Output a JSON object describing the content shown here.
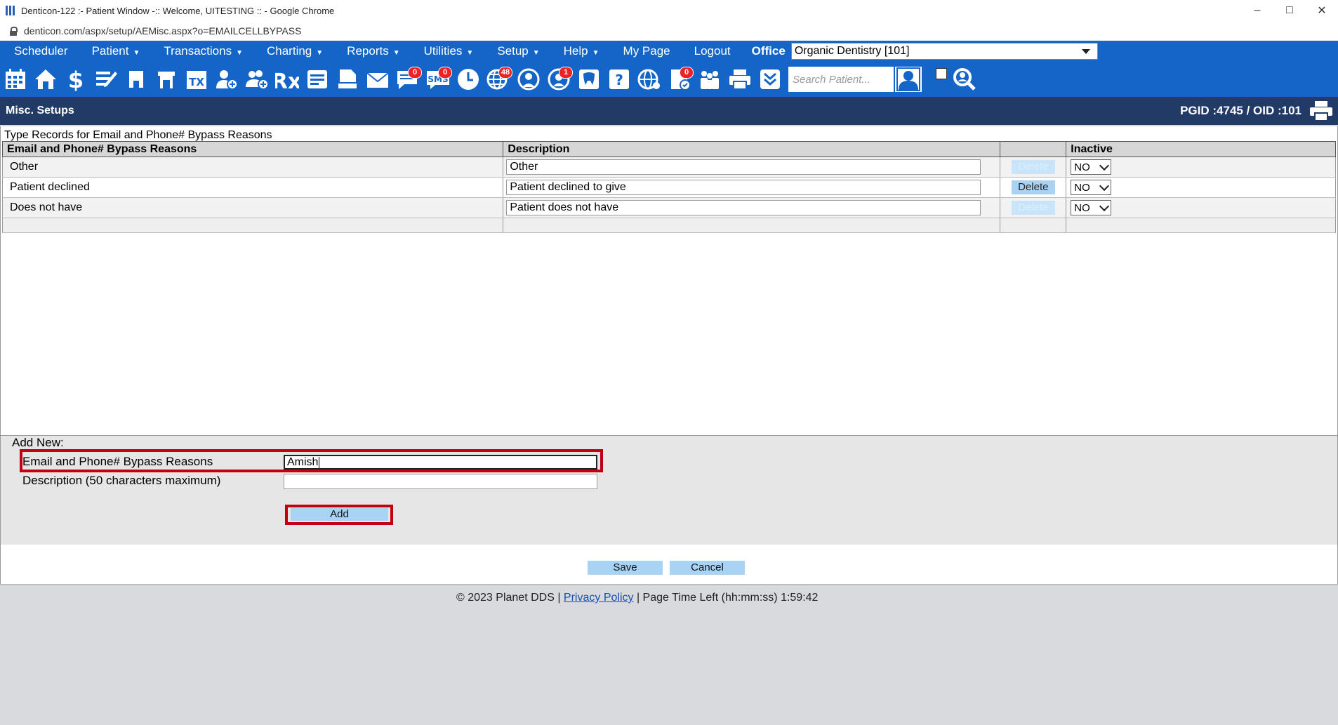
{
  "window": {
    "title": "Denticon-122 :- Patient Window -:: Welcome, UITESTING :: - Google Chrome",
    "url": "denticon.com/aspx/setup/AEMisc.aspx?o=EMAILCELLBYPASS"
  },
  "menu": {
    "items": [
      {
        "label": "Scheduler",
        "caret": false
      },
      {
        "label": "Patient",
        "caret": true
      },
      {
        "label": "Transactions",
        "caret": true
      },
      {
        "label": "Charting",
        "caret": true
      },
      {
        "label": "Reports",
        "caret": true
      },
      {
        "label": "Utilities",
        "caret": true
      },
      {
        "label": "Setup",
        "caret": true
      },
      {
        "label": "Help",
        "caret": true
      },
      {
        "label": "My Page",
        "caret": false
      },
      {
        "label": "Logout",
        "caret": false
      }
    ],
    "office_label": "Office",
    "office_value": "Organic Dentistry [101]"
  },
  "toolbar": {
    "search_placeholder": "Search Patient...",
    "badges": {
      "messages": "0",
      "sms": "0",
      "online": "48",
      "alerts": "1",
      "forms": "0"
    }
  },
  "subheader": {
    "title": "Misc. Setups",
    "ids": "PGID :4745  /  OID :101"
  },
  "table": {
    "caption": "Type Records for Email and Phone# Bypass Reasons",
    "headers": [
      "Email and Phone# Bypass Reasons",
      "Description",
      "",
      "Inactive"
    ],
    "rows": [
      {
        "name": "Other",
        "description": "Other",
        "delete_label": "Delete",
        "delete_enabled": false,
        "inactive": "NO"
      },
      {
        "name": "Patient declined",
        "description": "Patient declined to give",
        "delete_label": "Delete",
        "delete_enabled": true,
        "inactive": "NO"
      },
      {
        "name": "Does not have",
        "description": "Patient does not have",
        "delete_label": "Delete",
        "delete_enabled": false,
        "inactive": "NO"
      }
    ]
  },
  "add_new": {
    "label": "Add New:",
    "field1_label": "Email and Phone# Bypass Reasons",
    "field1_value": "Amish",
    "field2_label": "Description (50 characters maximum)",
    "field2_value": "",
    "add_button": "Add"
  },
  "actions": {
    "save": "Save",
    "cancel": "Cancel"
  },
  "footer": {
    "copyright": "© 2023 Planet DDS |",
    "privacy": "Privacy Policy",
    "time_left": "|  Page Time Left (hh:mm:ss) 1:59:42"
  },
  "colors": {
    "menu_bg": "#1565c8",
    "subheader_bg": "#213b66",
    "highlight": "#c00012",
    "button_bg": "#a8d3f5"
  }
}
